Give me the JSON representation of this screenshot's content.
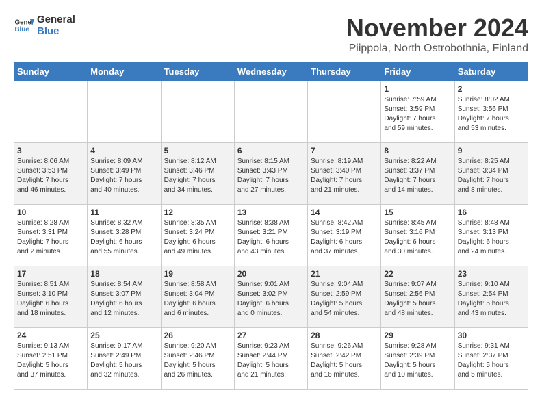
{
  "logo": {
    "line1": "General",
    "line2": "Blue"
  },
  "title": "November 2024",
  "subtitle": "Piippola, North Ostrobothnia, Finland",
  "headers": [
    "Sunday",
    "Monday",
    "Tuesday",
    "Wednesday",
    "Thursday",
    "Friday",
    "Saturday"
  ],
  "weeks": [
    [
      {
        "day": "",
        "info": ""
      },
      {
        "day": "",
        "info": ""
      },
      {
        "day": "",
        "info": ""
      },
      {
        "day": "",
        "info": ""
      },
      {
        "day": "",
        "info": ""
      },
      {
        "day": "1",
        "info": "Sunrise: 7:59 AM\nSunset: 3:59 PM\nDaylight: 7 hours\nand 59 minutes."
      },
      {
        "day": "2",
        "info": "Sunrise: 8:02 AM\nSunset: 3:56 PM\nDaylight: 7 hours\nand 53 minutes."
      }
    ],
    [
      {
        "day": "3",
        "info": "Sunrise: 8:06 AM\nSunset: 3:53 PM\nDaylight: 7 hours\nand 46 minutes."
      },
      {
        "day": "4",
        "info": "Sunrise: 8:09 AM\nSunset: 3:49 PM\nDaylight: 7 hours\nand 40 minutes."
      },
      {
        "day": "5",
        "info": "Sunrise: 8:12 AM\nSunset: 3:46 PM\nDaylight: 7 hours\nand 34 minutes."
      },
      {
        "day": "6",
        "info": "Sunrise: 8:15 AM\nSunset: 3:43 PM\nDaylight: 7 hours\nand 27 minutes."
      },
      {
        "day": "7",
        "info": "Sunrise: 8:19 AM\nSunset: 3:40 PM\nDaylight: 7 hours\nand 21 minutes."
      },
      {
        "day": "8",
        "info": "Sunrise: 8:22 AM\nSunset: 3:37 PM\nDaylight: 7 hours\nand 14 minutes."
      },
      {
        "day": "9",
        "info": "Sunrise: 8:25 AM\nSunset: 3:34 PM\nDaylight: 7 hours\nand 8 minutes."
      }
    ],
    [
      {
        "day": "10",
        "info": "Sunrise: 8:28 AM\nSunset: 3:31 PM\nDaylight: 7 hours\nand 2 minutes."
      },
      {
        "day": "11",
        "info": "Sunrise: 8:32 AM\nSunset: 3:28 PM\nDaylight: 6 hours\nand 55 minutes."
      },
      {
        "day": "12",
        "info": "Sunrise: 8:35 AM\nSunset: 3:24 PM\nDaylight: 6 hours\nand 49 minutes."
      },
      {
        "day": "13",
        "info": "Sunrise: 8:38 AM\nSunset: 3:21 PM\nDaylight: 6 hours\nand 43 minutes."
      },
      {
        "day": "14",
        "info": "Sunrise: 8:42 AM\nSunset: 3:19 PM\nDaylight: 6 hours\nand 37 minutes."
      },
      {
        "day": "15",
        "info": "Sunrise: 8:45 AM\nSunset: 3:16 PM\nDaylight: 6 hours\nand 30 minutes."
      },
      {
        "day": "16",
        "info": "Sunrise: 8:48 AM\nSunset: 3:13 PM\nDaylight: 6 hours\nand 24 minutes."
      }
    ],
    [
      {
        "day": "17",
        "info": "Sunrise: 8:51 AM\nSunset: 3:10 PM\nDaylight: 6 hours\nand 18 minutes."
      },
      {
        "day": "18",
        "info": "Sunrise: 8:54 AM\nSunset: 3:07 PM\nDaylight: 6 hours\nand 12 minutes."
      },
      {
        "day": "19",
        "info": "Sunrise: 8:58 AM\nSunset: 3:04 PM\nDaylight: 6 hours\nand 6 minutes."
      },
      {
        "day": "20",
        "info": "Sunrise: 9:01 AM\nSunset: 3:02 PM\nDaylight: 6 hours\nand 0 minutes."
      },
      {
        "day": "21",
        "info": "Sunrise: 9:04 AM\nSunset: 2:59 PM\nDaylight: 5 hours\nand 54 minutes."
      },
      {
        "day": "22",
        "info": "Sunrise: 9:07 AM\nSunset: 2:56 PM\nDaylight: 5 hours\nand 48 minutes."
      },
      {
        "day": "23",
        "info": "Sunrise: 9:10 AM\nSunset: 2:54 PM\nDaylight: 5 hours\nand 43 minutes."
      }
    ],
    [
      {
        "day": "24",
        "info": "Sunrise: 9:13 AM\nSunset: 2:51 PM\nDaylight: 5 hours\nand 37 minutes."
      },
      {
        "day": "25",
        "info": "Sunrise: 9:17 AM\nSunset: 2:49 PM\nDaylight: 5 hours\nand 32 minutes."
      },
      {
        "day": "26",
        "info": "Sunrise: 9:20 AM\nSunset: 2:46 PM\nDaylight: 5 hours\nand 26 minutes."
      },
      {
        "day": "27",
        "info": "Sunrise: 9:23 AM\nSunset: 2:44 PM\nDaylight: 5 hours\nand 21 minutes."
      },
      {
        "day": "28",
        "info": "Sunrise: 9:26 AM\nSunset: 2:42 PM\nDaylight: 5 hours\nand 16 minutes."
      },
      {
        "day": "29",
        "info": "Sunrise: 9:28 AM\nSunset: 2:39 PM\nDaylight: 5 hours\nand 10 minutes."
      },
      {
        "day": "30",
        "info": "Sunrise: 9:31 AM\nSunset: 2:37 PM\nDaylight: 5 hours\nand 5 minutes."
      }
    ]
  ]
}
